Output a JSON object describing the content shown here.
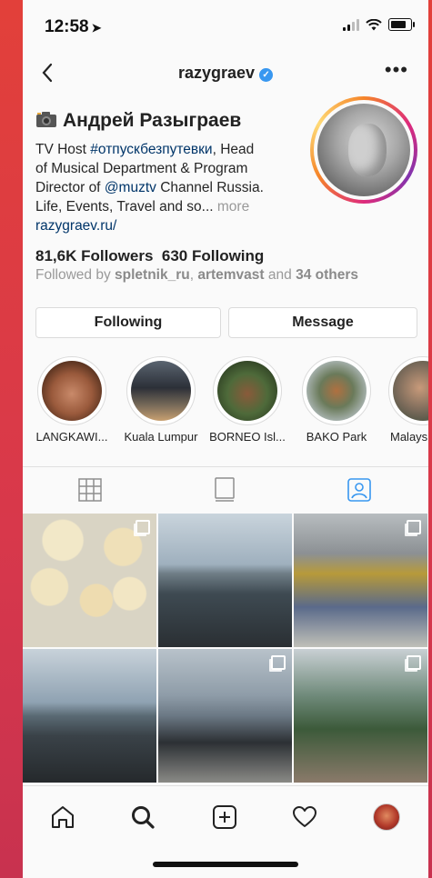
{
  "status": {
    "time": "12:58"
  },
  "header": {
    "username": "razygraev"
  },
  "profile": {
    "name": "Андрей Разыграев",
    "bio": {
      "line1_prefix": "TV Host ",
      "hashtag": "#отпускбезпутевки",
      "line1_suffix": ", Head",
      "line2": "of Musical Department & Program",
      "line3_prefix": "Director of ",
      "mention": "@muztv",
      "line3_suffix": " Channel Russia.",
      "line4": "Life, Events, Travel and so...",
      "more": " more",
      "link": "razygraev.ru/"
    },
    "followers": "81,6K Followers",
    "following": "630 Following",
    "followed_by": {
      "prefix": "Followed by ",
      "user1": "spletnik_ru",
      "sep": ", ",
      "user2": "artemvast",
      "mid": " and ",
      "others": "34 others"
    }
  },
  "actions": {
    "following": "Following",
    "message": "Message"
  },
  "highlights": [
    {
      "label": "LANGKAWI..."
    },
    {
      "label": "Kuala Lumpur"
    },
    {
      "label": "BORNEO Isl..."
    },
    {
      "label": "BAKO Park"
    },
    {
      "label": "Malays"
    }
  ],
  "tabs": [
    {
      "icon": "grid-icon"
    },
    {
      "icon": "igtv-icon"
    },
    {
      "icon": "tagged-icon",
      "active": true
    }
  ],
  "colors": {
    "accent": "#3897f0",
    "link": "#003569"
  },
  "bottom_nav": [
    "home-icon",
    "search-icon",
    "new-post-icon",
    "activity-heart-icon",
    "profile-avatar-icon"
  ]
}
